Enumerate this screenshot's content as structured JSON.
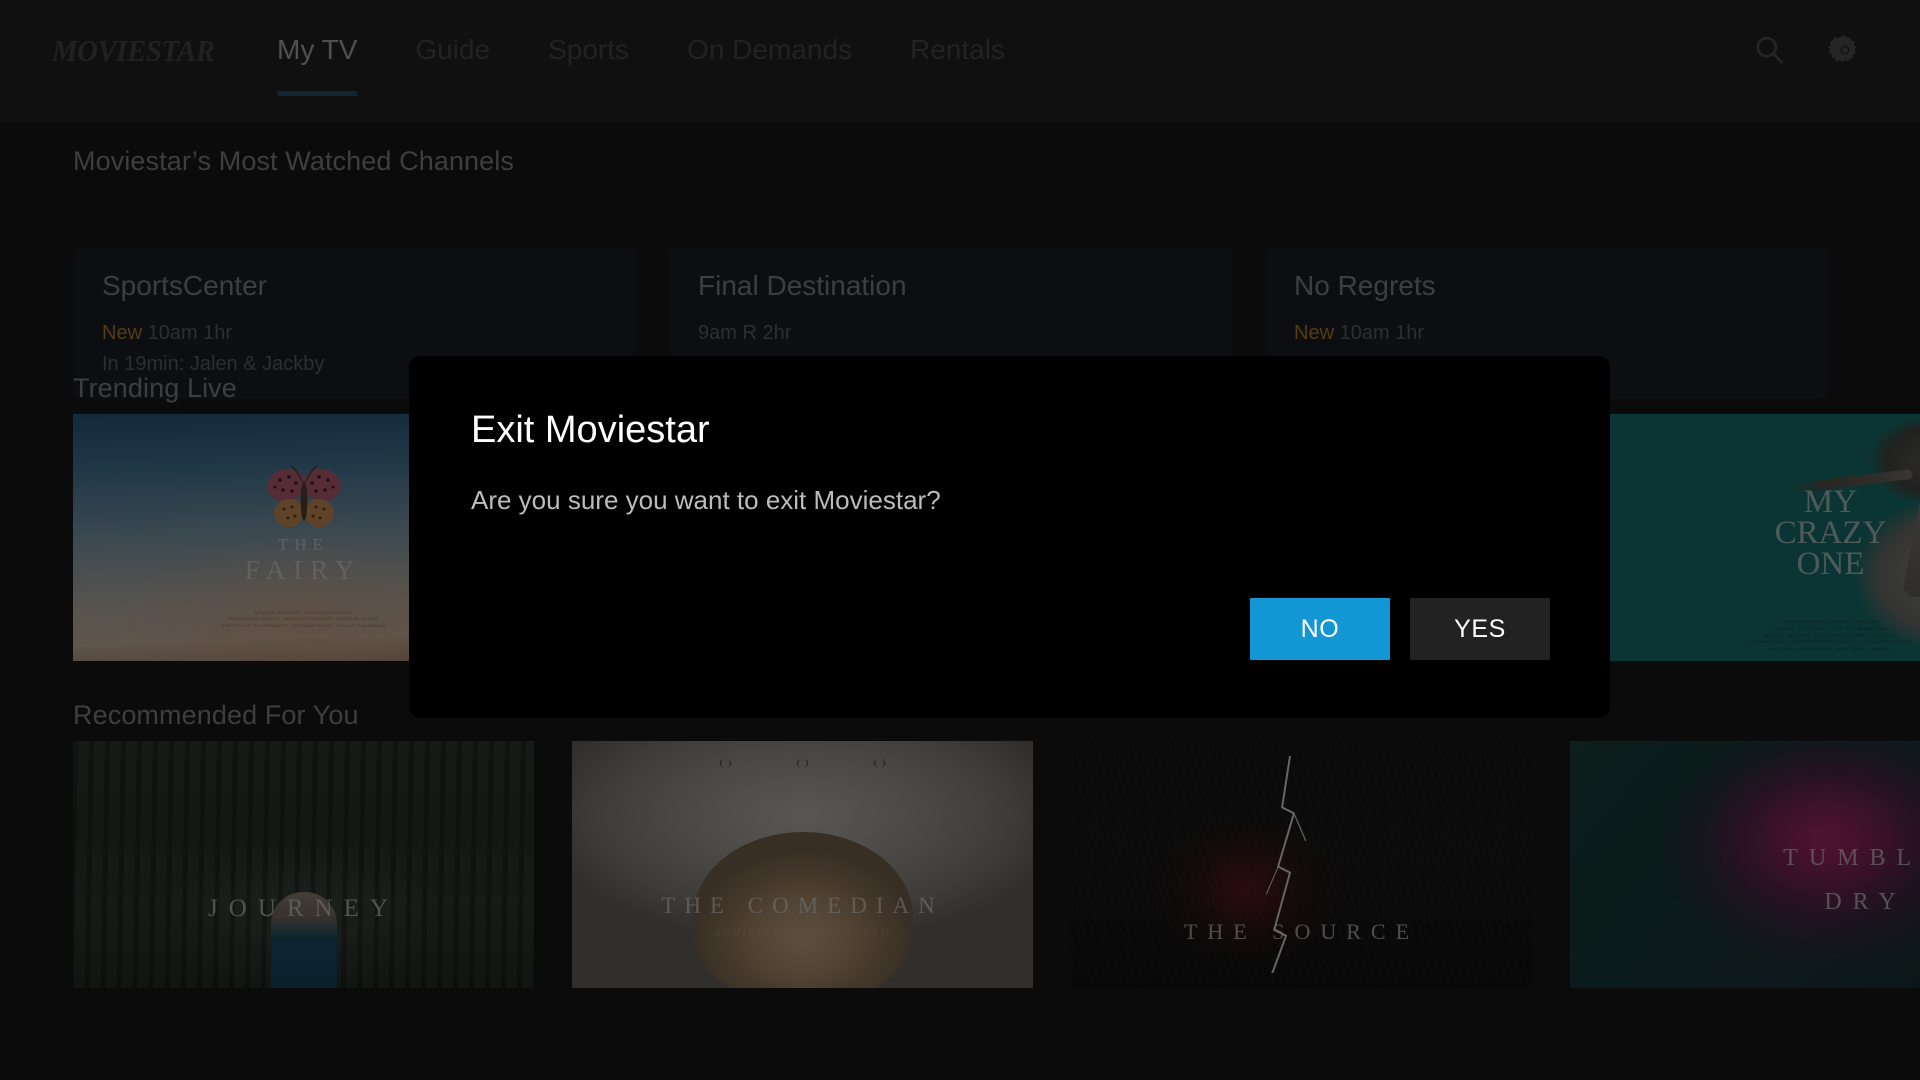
{
  "app": {
    "logo": "MOVIESTAR",
    "accent_active": "#2a5871",
    "accent_button": "#1296d4",
    "badge_color": "#c08a2a",
    "background": "#191919",
    "navbar_background": "#262626",
    "card_background": "#1c2028"
  },
  "nav": {
    "items": [
      {
        "label": "My TV",
        "active": true
      },
      {
        "label": "Guide",
        "active": false
      },
      {
        "label": "Sports",
        "active": false
      },
      {
        "label": "On Demands",
        "active": false
      },
      {
        "label": "Rentals",
        "active": false
      }
    ],
    "actions": [
      {
        "name": "search-icon",
        "label": "Search"
      },
      {
        "name": "gear-icon",
        "label": "Settings"
      }
    ]
  },
  "sections": {
    "most_watched": {
      "title": "Moviestar’s Most Watched Channels",
      "channels": [
        {
          "name": "SportsCenter",
          "badge": "New",
          "time": "10am 1hr",
          "next": "In 19min: Jalen & Jackby"
        },
        {
          "name": "Final Destination",
          "badge": "",
          "time": "9am R 2hr",
          "next": ""
        },
        {
          "name": "No Regrets",
          "badge": "New",
          "time": "10am 1hr",
          "next": ""
        }
      ]
    },
    "trending_live": {
      "title": "Trending Live",
      "posters": [
        {
          "title": "THE FAIRY",
          "title_line1": "THE",
          "title_line2": "FAIRY",
          "art": "fairy"
        },
        {
          "title": "",
          "title_line1": "",
          "title_line2": "",
          "art": "purple"
        },
        {
          "title": "",
          "title_line1": "",
          "title_line2": "",
          "art": "darkred"
        },
        {
          "title": "MY CRAZY ONE",
          "title_line1": "MY",
          "title_line2": "CRAZY",
          "title_line3": "ONE",
          "art": "teal"
        }
      ]
    },
    "recommended": {
      "title": "Recommended For You",
      "posters": [
        {
          "title": "JOURNEY",
          "art": "forest"
        },
        {
          "title": "THE COMEDIAN",
          "subtitle": "ACHIEVEMENT UNLOCKED",
          "art": "comedian"
        },
        {
          "title": "THE SOURCE",
          "art": "source"
        },
        {
          "title": "TUMBLE DRY",
          "title_line1": "TUMBLE",
          "title_line2": "DRY",
          "art": "tumble"
        }
      ]
    }
  },
  "dialog": {
    "title": "Exit Moviestar",
    "message": "Are you sure you want to exit Moviestar?",
    "no_label": "NO",
    "yes_label": "YES"
  }
}
